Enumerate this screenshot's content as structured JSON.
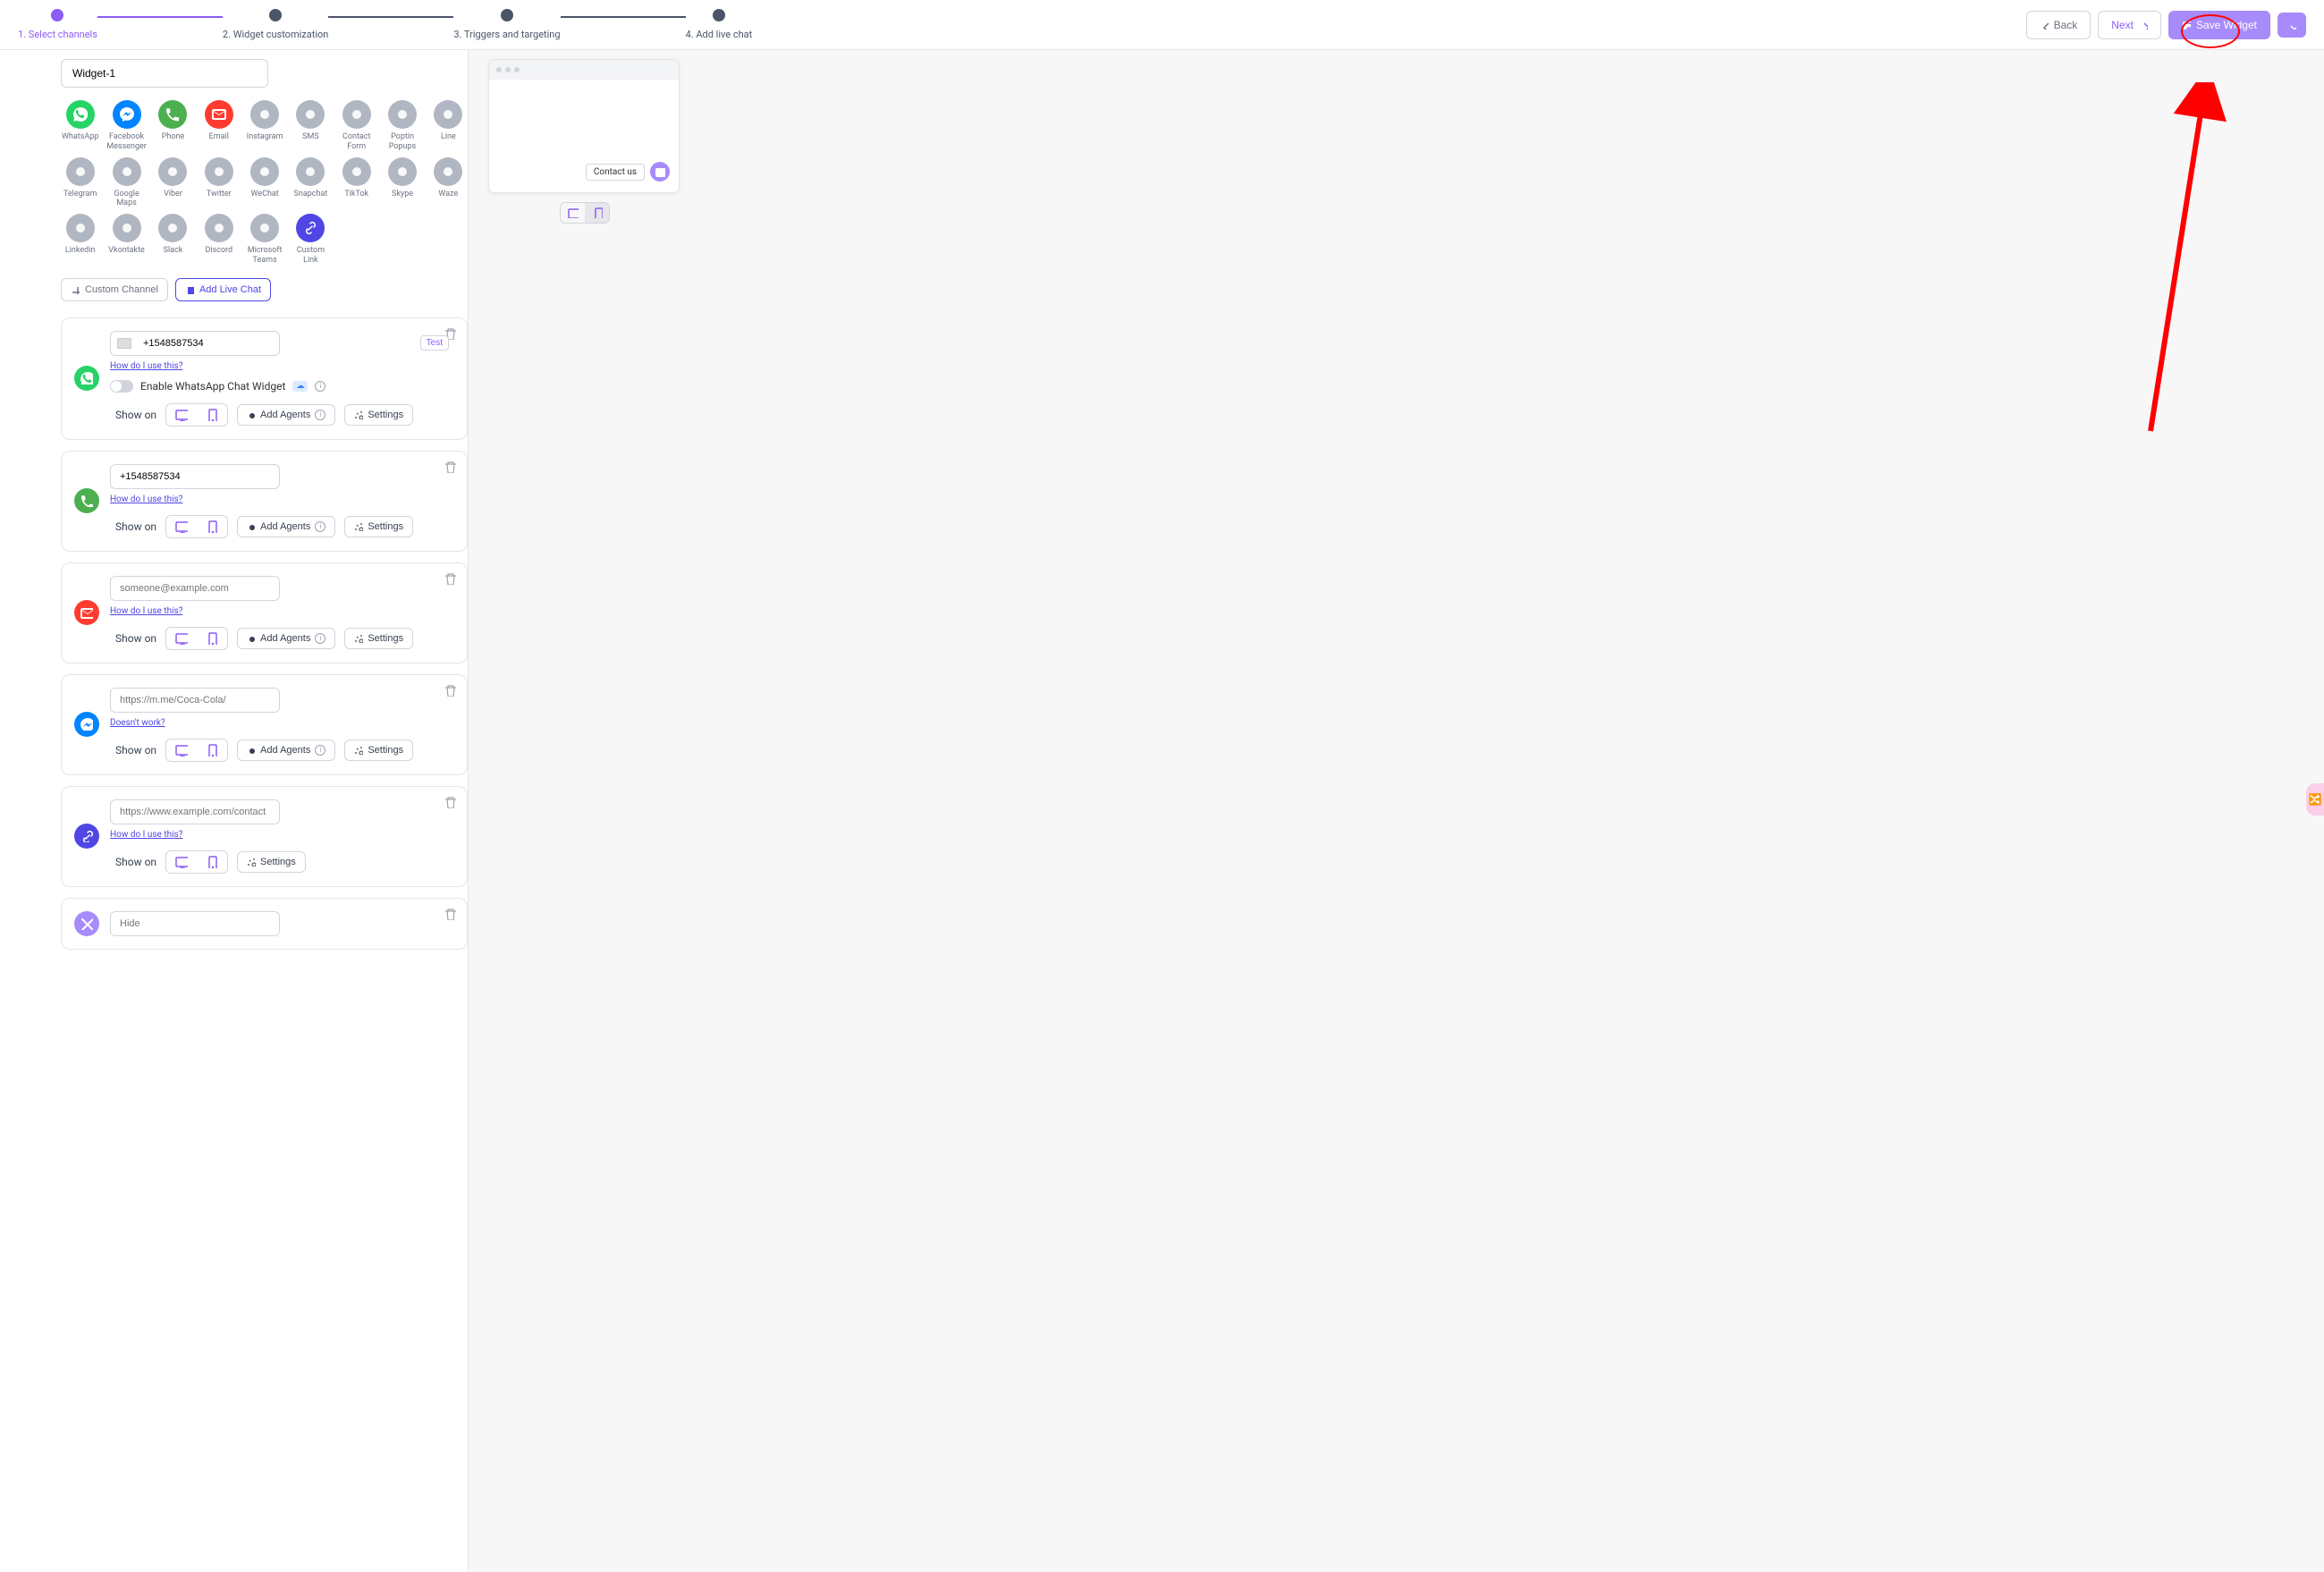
{
  "stepper": {
    "steps": [
      {
        "label": "1. Select channels",
        "active": true
      },
      {
        "label": "2. Widget customization",
        "active": false
      },
      {
        "label": "3. Triggers and targeting",
        "active": false
      },
      {
        "label": "4. Add live chat",
        "active": false
      }
    ]
  },
  "header": {
    "back": "Back",
    "next": "Next",
    "save": "Save Widget"
  },
  "widget_name": "Widget-1",
  "channels": [
    {
      "label": "WhatsApp",
      "color": "ci-green",
      "icon": "whatsapp"
    },
    {
      "label": "Facebook Messenger",
      "color": "ci-blue",
      "icon": "messenger"
    },
    {
      "label": "Phone",
      "color": "ci-darkgreen",
      "icon": "phone"
    },
    {
      "label": "Email",
      "color": "ci-red",
      "icon": "email"
    },
    {
      "label": "Instagram",
      "color": "ci-gray",
      "icon": "instagram"
    },
    {
      "label": "SMS",
      "color": "ci-gray",
      "icon": "sms"
    },
    {
      "label": "Contact Form",
      "color": "ci-gray",
      "icon": "contact"
    },
    {
      "label": "Poptin Popups",
      "color": "ci-gray",
      "icon": "poptin"
    },
    {
      "label": "Line",
      "color": "ci-gray",
      "icon": "line"
    },
    {
      "label": "Telegram",
      "color": "ci-gray",
      "icon": "telegram"
    },
    {
      "label": "Google Maps",
      "color": "ci-gray",
      "icon": "maps"
    },
    {
      "label": "Viber",
      "color": "ci-gray",
      "icon": "viber"
    },
    {
      "label": "Twitter",
      "color": "ci-gray",
      "icon": "twitter"
    },
    {
      "label": "WeChat",
      "color": "ci-gray",
      "icon": "wechat"
    },
    {
      "label": "Snapchat",
      "color": "ci-gray",
      "icon": "snapchat"
    },
    {
      "label": "TikTok",
      "color": "ci-gray",
      "icon": "tiktok"
    },
    {
      "label": "Skype",
      "color": "ci-gray",
      "icon": "skype"
    },
    {
      "label": "Waze",
      "color": "ci-gray",
      "icon": "waze"
    },
    {
      "label": "Linkedin",
      "color": "ci-gray",
      "icon": "linkedin"
    },
    {
      "label": "Vkontakte",
      "color": "ci-gray",
      "icon": "vk"
    },
    {
      "label": "Slack",
      "color": "ci-gray",
      "icon": "slack"
    },
    {
      "label": "Discord",
      "color": "ci-gray",
      "icon": "discord"
    },
    {
      "label": "Microsoft Teams",
      "color": "ci-gray",
      "icon": "teams"
    },
    {
      "label": "Custom Link",
      "color": "ci-link",
      "icon": "link"
    }
  ],
  "channel_buttons": {
    "custom": "Custom Channel",
    "live_chat": "Add Live Chat"
  },
  "cards": [
    {
      "color": "ci-green",
      "icon": "whatsapp",
      "value": "+1548587534",
      "has_flag": true,
      "has_test": true,
      "help": "How do I use this?",
      "toggle_label": "Enable WhatsApp Chat Widget",
      "show_on": "Show on",
      "add_agents": "Add Agents",
      "settings": "Settings"
    },
    {
      "color": "ci-darkgreen",
      "icon": "phone",
      "value": "+1548587534",
      "help": "How do I use this?",
      "show_on": "Show on",
      "add_agents": "Add Agents",
      "settings": "Settings"
    },
    {
      "color": "ci-red",
      "icon": "email",
      "placeholder": "someone@example.com",
      "help": "How do I use this?",
      "show_on": "Show on",
      "add_agents": "Add Agents",
      "settings": "Settings"
    },
    {
      "color": "ci-blue",
      "icon": "messenger",
      "placeholder": "https://m.me/Coca-Cola/",
      "help": "Doesn't work?",
      "show_on": "Show on",
      "add_agents": "Add Agents",
      "settings": "Settings"
    },
    {
      "color": "ci-link",
      "icon": "link",
      "placeholder": "https://www.example.com/contact",
      "help": "How do I use this?",
      "show_on": "Show on",
      "settings": "Settings"
    },
    {
      "color": "ci-purple",
      "icon": "close",
      "placeholder": "Hide"
    }
  ],
  "common": {
    "test": "Test",
    "badge": "☁"
  },
  "preview": {
    "contact_us": "Contact us"
  }
}
